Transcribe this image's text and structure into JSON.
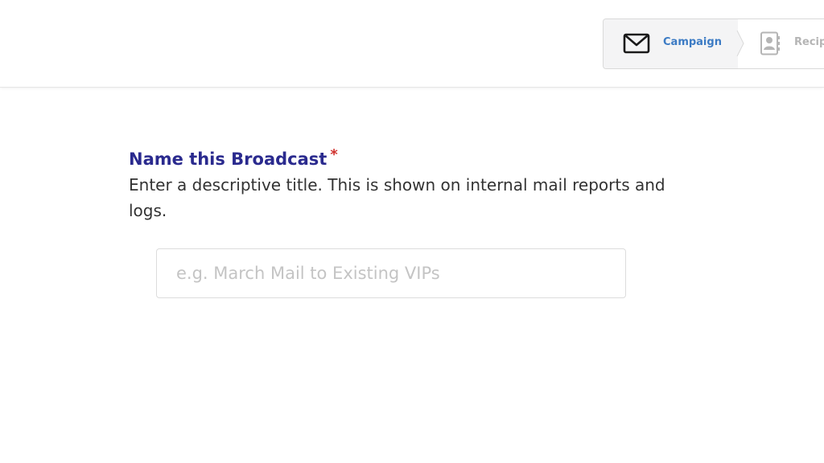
{
  "stepper": {
    "steps": [
      {
        "label": "Campaign",
        "icon": "envelope-icon",
        "active": true
      },
      {
        "label": "Recip",
        "icon": "contact-book-icon",
        "active": false
      }
    ],
    "active_color": "#3c7bc4",
    "inactive_color": "#b5b5b5"
  },
  "form": {
    "label": "Name this Broadcast",
    "required_mark": "*",
    "help": "Enter a descriptive title. This is shown on internal mail reports and logs.",
    "input": {
      "value": "",
      "placeholder": "e.g. March Mail to Existing VIPs"
    },
    "label_color": "#2a2a8e",
    "required_color": "#d0312d"
  }
}
